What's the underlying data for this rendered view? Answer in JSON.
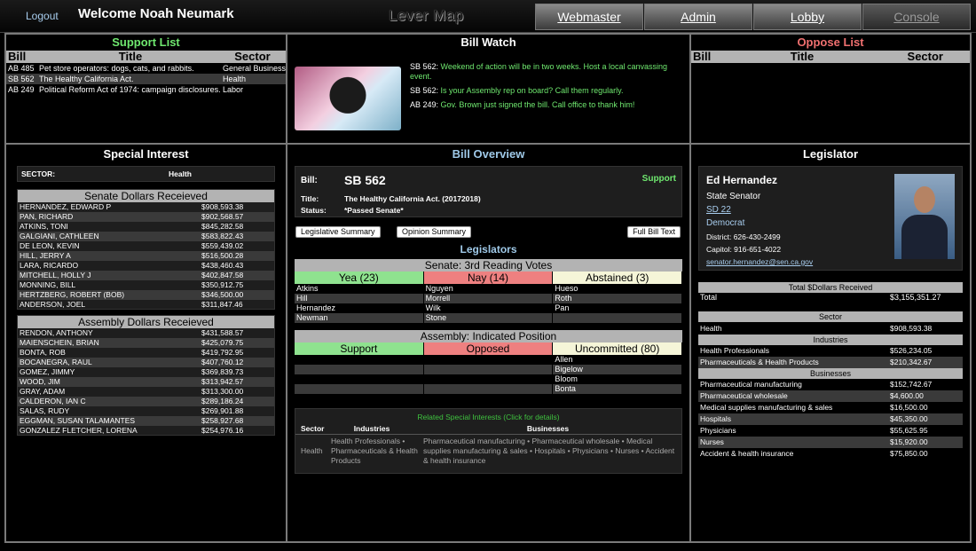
{
  "header": {
    "logout": "Logout",
    "welcome": "Welcome Noah Neumark",
    "app_title": "Lever Map",
    "tabs": [
      {
        "label": "Webmaster"
      },
      {
        "label": "Admin"
      },
      {
        "label": "Lobby"
      },
      {
        "label": "Console"
      }
    ]
  },
  "support_list": {
    "title": "Support List",
    "col_bill": "Bill",
    "col_title": "Title",
    "col_sector": "Sector",
    "rows": [
      {
        "bill": "AB 485",
        "title": "Pet store operators: dogs, cats, and rabbits.",
        "sector": "General Business"
      },
      {
        "bill": "SB 562",
        "title": "The Healthy California Act.",
        "sector": "Health"
      },
      {
        "bill": "AB 249",
        "title": "Political Reform Act of 1974: campaign disclosures.",
        "sector": "Labor"
      }
    ]
  },
  "bill_watch": {
    "title": "Bill Watch",
    "items": [
      {
        "bill": "SB 562:",
        "text": "Weekend of action will be in two weeks. Host a local canvassing event."
      },
      {
        "bill": "SB 562:",
        "text": "Is your Assembly rep on board? Call them regularly."
      },
      {
        "bill": "AB 249:",
        "text": "Gov. Brown just signed the bill. Call office to thank him!"
      }
    ]
  },
  "oppose_list": {
    "title": "Oppose List",
    "col_bill": "Bill",
    "col_title": "Title",
    "col_sector": "Sector"
  },
  "special_interest": {
    "title": "Special Interest",
    "sector_label": "SECTOR:",
    "sector_value": "Health",
    "senate_title": "Senate Dollars Receieved",
    "senate": [
      {
        "name": "HERNANDEZ, EDWARD P",
        "amount": "$908,593.38"
      },
      {
        "name": "PAN, RICHARD",
        "amount": "$902,568.57"
      },
      {
        "name": "ATKINS, TONI",
        "amount": "$845,282.58"
      },
      {
        "name": "GALGIANI, CATHLEEN",
        "amount": "$583,822.43"
      },
      {
        "name": "DE LEON, KEVIN",
        "amount": "$559,439.02"
      },
      {
        "name": "HILL, JERRY A",
        "amount": "$516,500.28"
      },
      {
        "name": "LARA, RICARDO",
        "amount": "$438,460.43"
      },
      {
        "name": "MITCHELL, HOLLY J",
        "amount": "$402,847.58"
      },
      {
        "name": "MONNING, BILL",
        "amount": "$350,912.75"
      },
      {
        "name": "HERTZBERG, ROBERT (BOB)",
        "amount": "$346,500.00"
      },
      {
        "name": "ANDERSON, JOEL",
        "amount": "$311,847.46"
      }
    ],
    "assembly_title": "Assembly Dollars Receieved",
    "assembly": [
      {
        "name": "RENDON, ANTHONY",
        "amount": "$431,588.57"
      },
      {
        "name": "MAIENSCHEIN, BRIAN",
        "amount": "$425,079.75"
      },
      {
        "name": "BONTA, ROB",
        "amount": "$419,792.95"
      },
      {
        "name": "BOCANEGRA, RAUL",
        "amount": "$407,760.12"
      },
      {
        "name": "GOMEZ, JIMMY",
        "amount": "$369,839.73"
      },
      {
        "name": "WOOD, JIM",
        "amount": "$313,942.57"
      },
      {
        "name": "GRAY, ADAM",
        "amount": "$313,300.00"
      },
      {
        "name": "CALDERON, IAN C",
        "amount": "$289,186.24"
      },
      {
        "name": "SALAS, RUDY",
        "amount": "$269,901.88"
      },
      {
        "name": "EGGMAN, SUSAN TALAMANTES",
        "amount": "$258,927.68"
      },
      {
        "name": "GONZALEZ FLETCHER, LORENA",
        "amount": "$254,976.16"
      }
    ]
  },
  "bill_overview": {
    "title": "Bill Overview",
    "bill_label": "Bill:",
    "bill_value": "SB 562",
    "position": "Support",
    "title_label": "Title:",
    "title_value": "The Healthy California Act. (20172018)",
    "status_label": "Status:",
    "status_value": "*Passed Senate*",
    "btn_leg": "Legislative Summary",
    "btn_op": "Opinion Summary",
    "btn_full": "Full Bill Text",
    "legislators_title": "Legislators",
    "senate_title": "Senate: 3rd Reading Votes",
    "yea": "Yea (23)",
    "nay": "Nay (14)",
    "abstained": "Abstained (3)",
    "senate_rows": [
      [
        "Atkins",
        "Nguyen",
        "Hueso"
      ],
      [
        "Hill",
        "Morrell",
        "Roth"
      ],
      [
        "Hernandez",
        "Wilk",
        "Pan"
      ],
      [
        "Newman",
        "Stone",
        ""
      ]
    ],
    "assembly_title": "Assembly: Indicated Position",
    "support": "Support",
    "opposed": "Opposed",
    "uncommitted": "Uncommitted (80)",
    "assembly_rows": [
      "Allen",
      "Bigelow",
      "Bloom",
      "Bonta"
    ],
    "related_title": "Related Special Interests (Click for details)",
    "col_sector": "Sector",
    "col_industries": "Industries",
    "col_businesses": "Businesses",
    "related": {
      "sector": "Health",
      "industries": "Health Professionals • Pharmaceuticals & Health Products",
      "businesses": "Pharmaceutical manufacturing • Pharmaceutical wholesale • Medical supplies manufacturing & sales • Hospitals • Physicians • Nurses • Accident & health insurance"
    }
  },
  "legislator": {
    "title": "Legislator",
    "name": "Ed Hernandez",
    "role": "State Senator",
    "district": "SD 22",
    "party": "Democrat",
    "district_phone": "District: 626-430-2499",
    "capitol_phone": "Capitol: 916-651-4022",
    "email": "senator.hernandez@sen.ca.gov",
    "total_title": "Total $Dollars Received",
    "total_label": "Total",
    "total_value": "$3,155,351.27",
    "sector_title": "Sector",
    "sector_name": "Health",
    "sector_value": "$908,593.38",
    "industries_title": "Industries",
    "industries": [
      {
        "name": "Health Professionals",
        "amount": "$526,234.05"
      },
      {
        "name": "Pharmaceuticals & Health Products",
        "amount": "$210,342.67"
      }
    ],
    "businesses_title": "Businesses",
    "businesses": [
      {
        "name": "Pharmaceutical manufacturing",
        "amount": "$152,742.67"
      },
      {
        "name": "Pharmaceutical wholesale",
        "amount": "$4,600.00"
      },
      {
        "name": "Medical supplies manufacturing & sales",
        "amount": "$16,500.00"
      },
      {
        "name": "Hospitals",
        "amount": "$45,350.00"
      },
      {
        "name": "Physicians",
        "amount": "$55,625.95"
      },
      {
        "name": "Nurses",
        "amount": "$15,920.00"
      },
      {
        "name": "Accident & health insurance",
        "amount": "$75,850.00"
      }
    ]
  }
}
